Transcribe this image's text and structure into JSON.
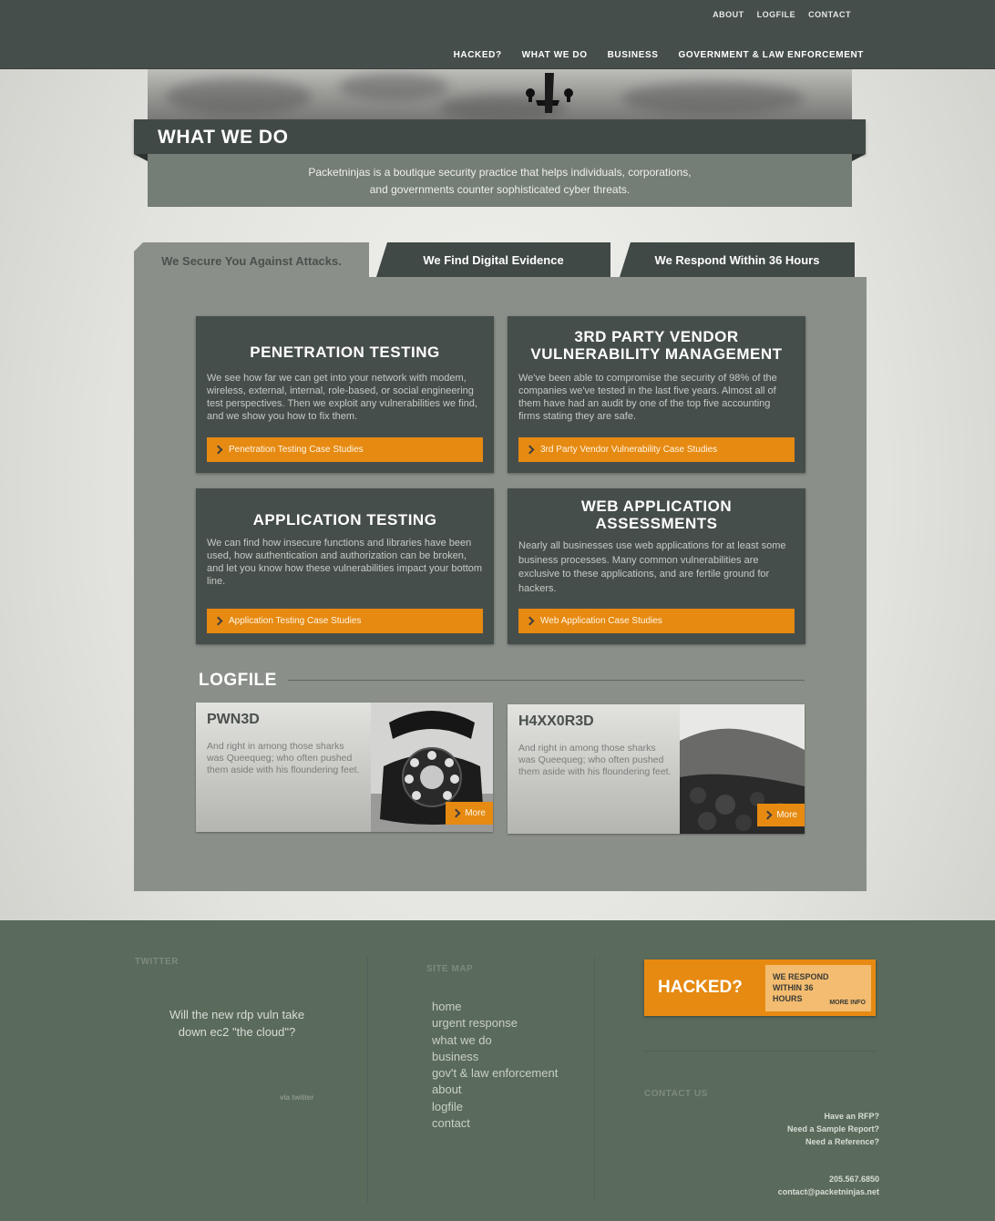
{
  "util_nav": [
    "ABOUT",
    "LOGFILE",
    "CONTACT"
  ],
  "main_nav": [
    "HACKED?",
    "WHAT WE DO",
    "BUSINESS",
    "GOVERNMENT & LAW ENFORCEMENT"
  ],
  "page_title": "WHAT WE DO",
  "intro": {
    "line1": "Packetninjas is a boutique security practice that helps individuals, corporations,",
    "line2": "and governments counter sophisticated cyber threats."
  },
  "tabs": [
    {
      "label": "We Secure You Against Attacks.",
      "active": true
    },
    {
      "label": "We Find Digital Evidence",
      "active": false
    },
    {
      "label": "We Respond Within 36 Hours",
      "active": false
    }
  ],
  "services": [
    {
      "title_line1": "PENETRATION TESTING",
      "title_line2": "",
      "body": "We see how far we can get into your network with modem, wireless, external, internal, role-based, or social engineering test perspectives. Then we exploit any vulnerabilities we find, and we show you how to fix them.",
      "button": "Penetration Testing Case Studies"
    },
    {
      "title_line1": "3RD PARTY VENDOR",
      "title_line2": "VULNERABILITY MANAGEMENT",
      "body": "We've been able to compromise the security of 98% of the companies we've tested in the last five years. Almost all of them have had an audit by one of the top five accounting firms stating they are safe.",
      "button": "3rd Party Vendor Vulnerability Case Studies"
    },
    {
      "title_line1": "APPLICATION TESTING",
      "title_line2": "",
      "body": "We can find how insecure functions and libraries have been used, how authentication and authorization can be broken, and let you know how these vulnerabilities impact your bottom line.",
      "button": "Application Testing Case Studies"
    },
    {
      "title_line1": "WEB APPLICATION",
      "title_line2": "ASSESSMENTS",
      "body": "Nearly all businesses use web applications for at least some business processes. Many common vulnerabilities are exclusive to these applications, and are fertile ground for hackers.",
      "button": "Web Application Case Studies"
    }
  ],
  "logfile": {
    "title": "LOGFILE",
    "posts": [
      {
        "title": "PWN3D",
        "excerpt": "And right in among those sharks was Queequeg; who often pushed them aside with his floundering feet.",
        "more": "More"
      },
      {
        "title": "H4XX0R3D",
        "excerpt": "And right in among those sharks was Queequeg; who often pushed them aside with his floundering feet.",
        "more": "More"
      }
    ]
  },
  "footer": {
    "twitter_label": "TWITTER",
    "tweet": "Will the new rdp vuln take down ec2 \"the cloud\"?",
    "via": "via twitter",
    "sitemap_label": "SITE MAP",
    "sitemap": [
      "home",
      "urgent response",
      "what we do",
      "business",
      "gov't & law enforcement",
      "about",
      "logfile",
      "contact"
    ],
    "hacked": {
      "label": "HACKED?",
      "respond_line1": "WE RESPOND",
      "respond_line2": "WITHIN 36",
      "respond_line3": "HOURS",
      "more": "MORE INFO"
    },
    "contact_label": "CONTACT US",
    "contact_links": [
      "Have an RFP?",
      "Need a Sample Report?",
      "Need a Reference?"
    ],
    "phone": "205.567.6850",
    "email": "contact@packetninjas.net"
  },
  "colors": {
    "header_bg": "#464e4b",
    "panel_bg": "#8a9089",
    "card_bg": "#464e4b",
    "accent_orange": "#e68a12",
    "footer_bg": "#5a6a5b"
  }
}
